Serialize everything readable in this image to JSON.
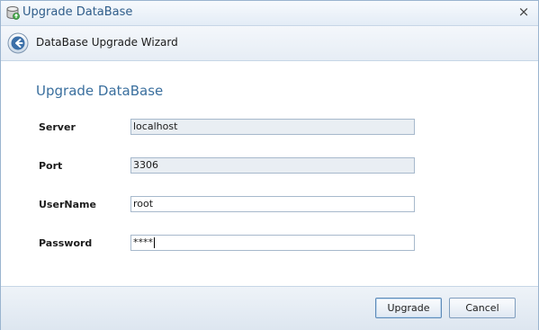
{
  "window": {
    "title": "Upgrade DataBase",
    "close_glyph": "×",
    "title_icon": "database-icon"
  },
  "wizard": {
    "back_icon": "back-arrow-icon",
    "title": "DataBase Upgrade Wizard"
  },
  "form": {
    "section_title": "Upgrade DataBase",
    "fields": [
      {
        "label": "Server",
        "value": "localhost",
        "editable": false
      },
      {
        "label": "Port",
        "value": "3306",
        "editable": false
      },
      {
        "label": "UserName",
        "value": "root",
        "editable": true
      },
      {
        "label": "Password",
        "value": "****",
        "editable": true
      }
    ]
  },
  "footer": {
    "upgrade_label": "Upgrade",
    "cancel_label": "Cancel"
  },
  "colors": {
    "accent": "#3a6f9e",
    "title_text": "#2f5d8a",
    "border": "#9ab4cf"
  }
}
